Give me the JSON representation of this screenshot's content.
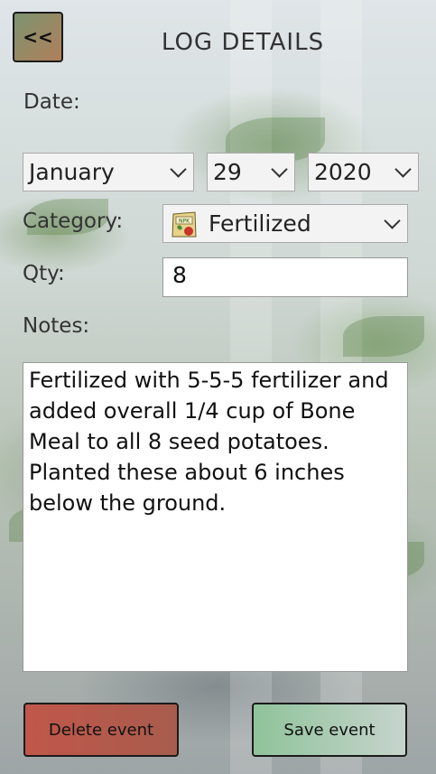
{
  "header": {
    "back_label": "<<",
    "title": "LOG DETAILS"
  },
  "form": {
    "date_label": "Date:",
    "month": "January",
    "day": "29",
    "year": "2020",
    "category_label": "Category:",
    "category": "Fertilized",
    "category_icon": "fertilizer-bag-icon",
    "qty_label": "Qty:",
    "qty": "8",
    "notes_label": "Notes:",
    "notes": "Fertilized with 5-5-5 fertilizer and added overall 1/4 cup of Bone Meal to all 8 seed potatoes.  Planted these about 6 inches below the ground."
  },
  "icon_text": {
    "bag": "NPK"
  },
  "actions": {
    "delete_label": "Delete event",
    "save_label": "Save event"
  },
  "colors": {
    "delete": "#b85a4c",
    "save": "#a9cdb0",
    "back": "#9a8a66"
  }
}
